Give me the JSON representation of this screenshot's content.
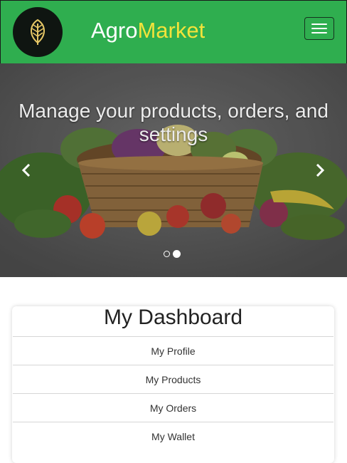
{
  "navbar": {
    "brand_part1": "Agro",
    "brand_part2": "Market",
    "logo_icon": "leaf-icon",
    "toggle_icon": "hamburger-icon",
    "colors": {
      "navbar": "#2fae4f",
      "brand_highlight": "#f2e33b",
      "logo_bg": "#0f1511",
      "logo_leaf": "#e6c766"
    }
  },
  "hero": {
    "caption": "Manage your products, orders, and settings",
    "prev_icon": "chevron-left-icon",
    "next_icon": "chevron-right-icon",
    "image": "vegetable-basket",
    "slides": 2,
    "active_slide": 2
  },
  "dashboard": {
    "title": "My Dashboard",
    "items": [
      {
        "label": "My Profile"
      },
      {
        "label": "My Products"
      },
      {
        "label": "My Orders"
      },
      {
        "label": "My Wallet"
      }
    ]
  }
}
